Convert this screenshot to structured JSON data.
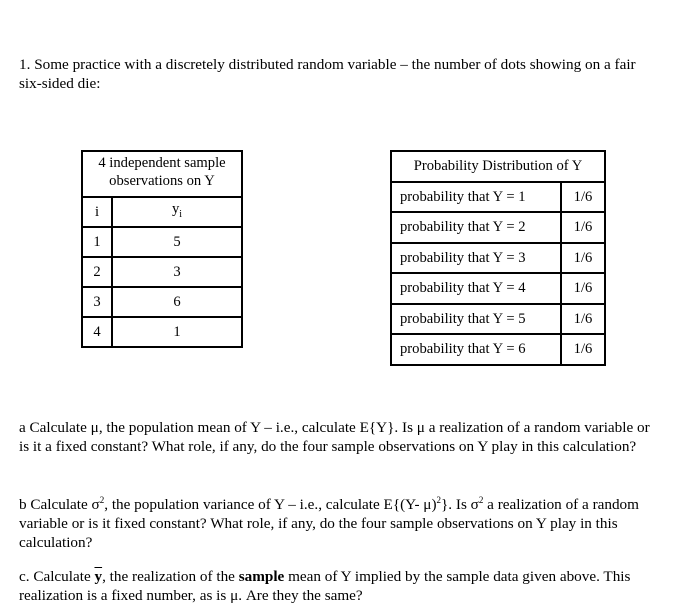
{
  "intro": "1.  Some practice with a discretely distributed random variable – the number of dots showing on a fair six-sided die:",
  "sample_table": {
    "header": "4 independent sample observations on Y",
    "col_i": "i",
    "col_y": "y",
    "col_y_sub": "i",
    "rows": [
      {
        "i": "1",
        "y": "5"
      },
      {
        "i": "2",
        "y": "3"
      },
      {
        "i": "3",
        "y": "6"
      },
      {
        "i": "4",
        "y": "1"
      }
    ]
  },
  "dist_table": {
    "header": "Probability Distribution of Y",
    "rows": [
      {
        "label": "probability that Y = 1",
        "value": "1/6"
      },
      {
        "label": "probability that Y = 2",
        "value": "1/6"
      },
      {
        "label": "probability that Y = 3",
        "value": "1/6"
      },
      {
        "label": "probability that Y = 4",
        "value": "1/6"
      },
      {
        "label": "probability that Y = 5",
        "value": "1/6"
      },
      {
        "label": "probability that Y = 6",
        "value": "1/6"
      }
    ]
  },
  "questions": {
    "a": "a Calculate μ, the population mean of Y – i.e., calculate  E{Y}.  Is μ a realization of a random variable or is it a fixed constant?  What role, if any, do the four sample observations on Y play in this calculation?",
    "b_part1": "b Calculate σ",
    "b_part2": ", the population variance of Y – i.e., calculate  E{(Y- μ)",
    "b_part3": "}.   Is σ",
    "b_part4": " a realization of a random variable or is it fixed constant?  What role, if any, do the four sample observations on Y play in this calculation?",
    "sup2": "2",
    "c_part1": "c. Calculate ",
    "c_ybar": "y",
    "c_part2": ", the realization of the ",
    "c_bold": "sample",
    "c_part3": " mean of Y implied by the sample data given above. This realization is a fixed number, as is μ.  Are they the same?"
  }
}
